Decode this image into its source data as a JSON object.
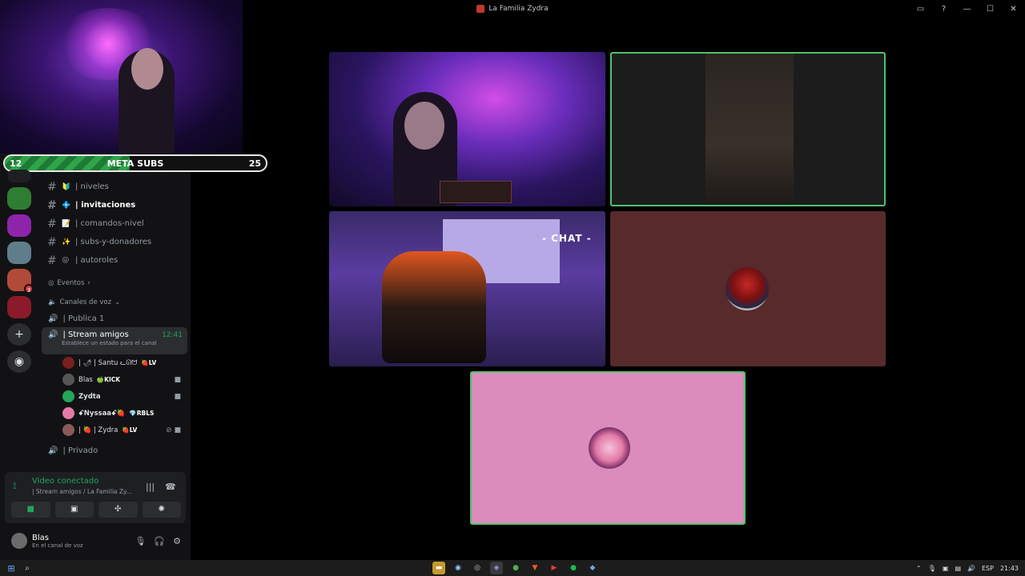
{
  "window": {
    "title": "La Familia Zydra"
  },
  "subs_bar": {
    "label": "META SUBS",
    "current": "12",
    "goal": "25",
    "progress_fraction": 0.48
  },
  "server_rail": {
    "badges": [
      "3"
    ]
  },
  "channels": [
    {
      "emoji": "🔰",
      "label": "| niveles",
      "active": false
    },
    {
      "emoji": "💠",
      "label": "| invitaciones",
      "active": true
    },
    {
      "emoji": "📝",
      "label": "| comandos-nivel",
      "active": false
    },
    {
      "emoji": "✨",
      "label": "| subs-y-donadores",
      "active": false
    },
    {
      "emoji": "😜",
      "label": "| autoroles",
      "active": false
    }
  ],
  "events_label": "Eventos",
  "voice_category": "Canales de voz",
  "voice_channels": {
    "publica": "| Publica 1",
    "stream": {
      "label": "| Stream amigos",
      "time": "12:41",
      "status": "Establece un estado para el canal"
    },
    "privado": "| Privado"
  },
  "voice_users": [
    {
      "name": "| 🌶 | Santu ᓚᘏᗢ",
      "tag": "🍓LV"
    },
    {
      "name": "Blas",
      "tag": "🍏KICK"
    },
    {
      "name": "Zydta",
      "tag": ""
    },
    {
      "name": "ꗃNyssaaꗃ🍓",
      "tag": "💎RBLS"
    },
    {
      "name": "| 🍓 | Zydra",
      "tag": "🍓LV"
    }
  ],
  "voice_panel": {
    "status": "Video conectado",
    "channel": "| Stream amigos / La Familia Zy..."
  },
  "user": {
    "name": "Blas",
    "status": "En el canal de voz"
  },
  "stream": {
    "chat_overlay": "- CHAT -"
  },
  "taskbar": {
    "lang": "ESP",
    "time": "21:43"
  }
}
